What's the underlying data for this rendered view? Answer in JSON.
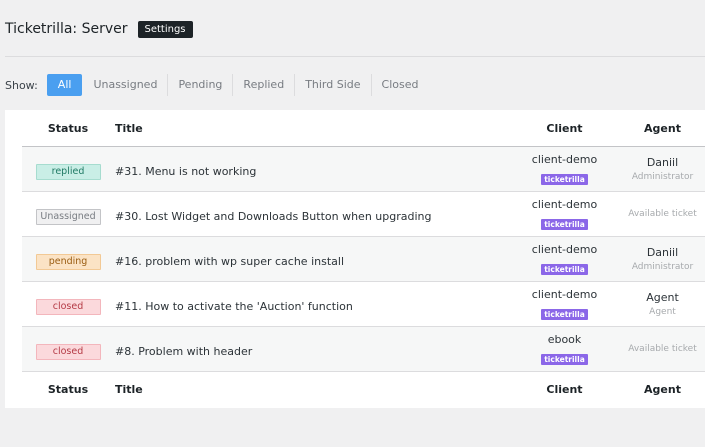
{
  "header": {
    "title": "Ticketrilla: Server",
    "settings_label": "Settings"
  },
  "filters": {
    "show_label": "Show:",
    "items": [
      "All",
      "Unassigned",
      "Pending",
      "Replied",
      "Third Side",
      "Closed"
    ],
    "active": "All"
  },
  "columns": {
    "status": "Status",
    "title": "Title",
    "client": "Client",
    "agent": "Agent"
  },
  "tickets": [
    {
      "status": "replied",
      "status_label": "replied",
      "title": "#31. Menu is not working",
      "client": "client-demo",
      "client_tag": "ticketrilla",
      "agent_name": "Daniil",
      "agent_role": "Administrator"
    },
    {
      "status": "unassigned",
      "status_label": "Unassigned",
      "title": "#30. Lost Widget and Downloads Button when upgrading",
      "client": "client-demo",
      "client_tag": "ticketrilla",
      "agent_available": "Available ticket"
    },
    {
      "status": "pending",
      "status_label": "pending",
      "title": "#16. problem with wp super cache install",
      "client": "client-demo",
      "client_tag": "ticketrilla",
      "agent_name": "Daniil",
      "agent_role": "Administrator"
    },
    {
      "status": "closed",
      "status_label": "closed",
      "title": "#11. How to activate the 'Auction' function",
      "client": "client-demo",
      "client_tag": "ticketrilla",
      "agent_name": "Agent",
      "agent_role": "Agent"
    },
    {
      "status": "closed",
      "status_label": "closed",
      "title": "#8. Problem with header",
      "client": "ebook",
      "client_tag": "ticketrilla",
      "agent_available": "Available ticket"
    }
  ],
  "colors": {
    "filter_active": "#4a9ff0",
    "client_tag": "#8b67e8",
    "replied": "#c9eee6",
    "pending": "#fbe3c5",
    "closed": "#fbd9dc",
    "unassigned": "#f0f0f1"
  }
}
